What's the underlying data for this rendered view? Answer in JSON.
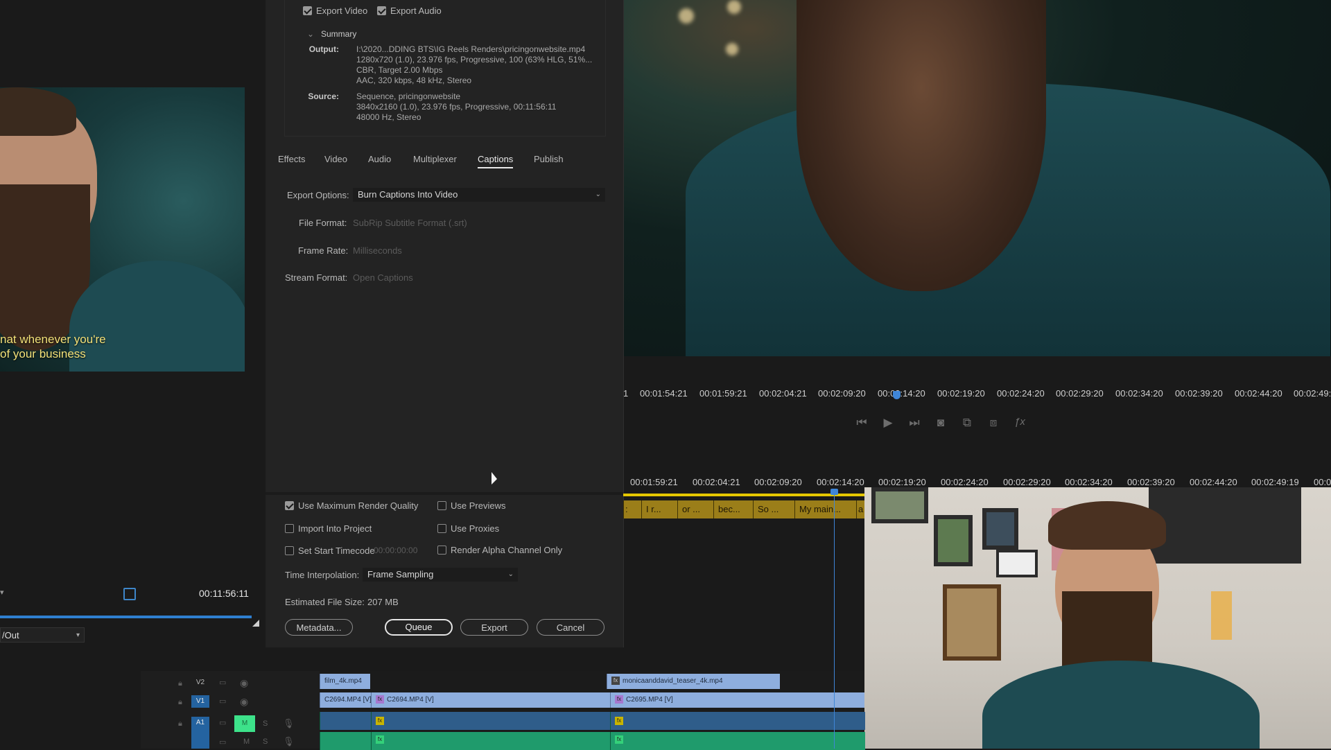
{
  "export": {
    "export_video_label": "Export Video",
    "export_audio_label": "Export Audio",
    "summary_title": "Summary",
    "output_key": "Output:",
    "output_lines": [
      "I:\\2020...DDING BTS\\IG Reels Renders\\pricingonwebsite.mp4",
      "1280x720 (1.0), 23.976 fps, Progressive, 100 (63% HLG, 51%...",
      "CBR, Target 2.00 Mbps",
      "AAC, 320 kbps, 48 kHz, Stereo"
    ],
    "source_key": "Source:",
    "source_lines": [
      "Sequence, pricingonwebsite",
      "3840x2160 (1.0), 23.976 fps, Progressive, 00:11:56:11",
      "48000 Hz, Stereo"
    ],
    "tabs": [
      "Effects",
      "Video",
      "Audio",
      "Multiplexer",
      "Captions",
      "Publish"
    ],
    "active_tab": "Captions",
    "captions": {
      "export_options_label": "Export Options:",
      "export_options_value": "Burn Captions Into Video",
      "file_format_label": "File Format:",
      "file_format_value": "SubRip Subtitle Format (.srt)",
      "frame_rate_label": "Frame Rate:",
      "frame_rate_value": "Milliseconds",
      "stream_format_label": "Stream Format:",
      "stream_format_value": "Open Captions"
    },
    "options": {
      "use_max_render_quality": "Use Maximum Render Quality",
      "use_previews": "Use Previews",
      "import_into_project": "Import Into Project",
      "use_proxies": "Use Proxies",
      "set_start_timecode": "Set Start Timecode",
      "start_timecode_value": "00:00:00:00",
      "render_alpha": "Render Alpha Channel Only",
      "time_interp_label": "Time Interpolation:",
      "time_interp_value": "Frame Sampling",
      "est_size_label": "Estimated File Size:",
      "est_size_value": "207 MB"
    },
    "buttons": {
      "metadata": "Metadata...",
      "queue": "Queue",
      "export": "Export",
      "cancel": "Cancel"
    }
  },
  "source_monitor": {
    "caption_line_1": "nat whenever you're",
    "caption_line_2": "of your business",
    "timecode": "00:11:56:11",
    "inout_value": "/Out",
    "progress_fraction": 1.0
  },
  "program_ruler": [
    "1",
    "00:01:54:21",
    "00:01:59:21",
    "00:02:04:21",
    "00:02:09:20",
    "00:02:14:20",
    "00:02:19:20",
    "00:02:24:20",
    "00:02:29:20",
    "00:02:34:20",
    "00:02:39:20",
    "00:02:44:20",
    "00:02:49:"
  ],
  "sequence_ruler": [
    "00:01:59:21",
    "00:02:04:21",
    "00:02:09:20",
    "00:02:14:20",
    "00:02:19:20",
    "00:02:24:20",
    "00:02:29:20",
    "00:02:34:20",
    "00:02:39:20",
    "00:02:44:20",
    "00:02:49:19",
    "00:0"
  ],
  "caption_clips": [
    ":",
    "I r...",
    "or ...",
    "bec...",
    "So ...",
    "My main...",
    "a"
  ],
  "tracks": {
    "v2": "V2",
    "v1": "V1",
    "a1": "A1",
    "mute_m": "M",
    "solo_s": "S",
    "v2_clips": [
      "film_4k.mp4",
      "monicaanddavid_teaser_4k.mp4"
    ],
    "v1_clips": [
      "C2694.MP4 [V]",
      "C2694.MP4 [V]",
      "C2695.MP4 [V]"
    ],
    "fx": "fx"
  },
  "colors": {
    "accent_blue": "#3f86d8",
    "caption_track": "#9b7e19",
    "video_clip": "#8eaede",
    "audio_clip": "#1f9b6c"
  }
}
